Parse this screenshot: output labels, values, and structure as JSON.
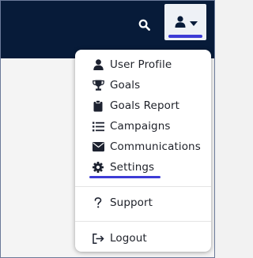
{
  "header": {
    "search_icon": "search-icon",
    "user_icon": "user-icon",
    "caret_icon": "caret-down-icon",
    "background_color": "#071b39",
    "accent_color": "#3d3bd6"
  },
  "menu": {
    "items": [
      {
        "label": "User Profile",
        "icon": "user-icon"
      },
      {
        "label": "Goals",
        "icon": "trophy-icon"
      },
      {
        "label": "Goals Report",
        "icon": "clipboard-icon"
      },
      {
        "label": "Campaigns",
        "icon": "list-icon"
      },
      {
        "label": "Communications",
        "icon": "envelope-icon"
      },
      {
        "label": "Settings",
        "icon": "gear-icon",
        "active": true
      },
      {
        "label": "Support",
        "icon": "question-icon"
      },
      {
        "label": "Logout",
        "icon": "sign-out-icon"
      }
    ]
  }
}
